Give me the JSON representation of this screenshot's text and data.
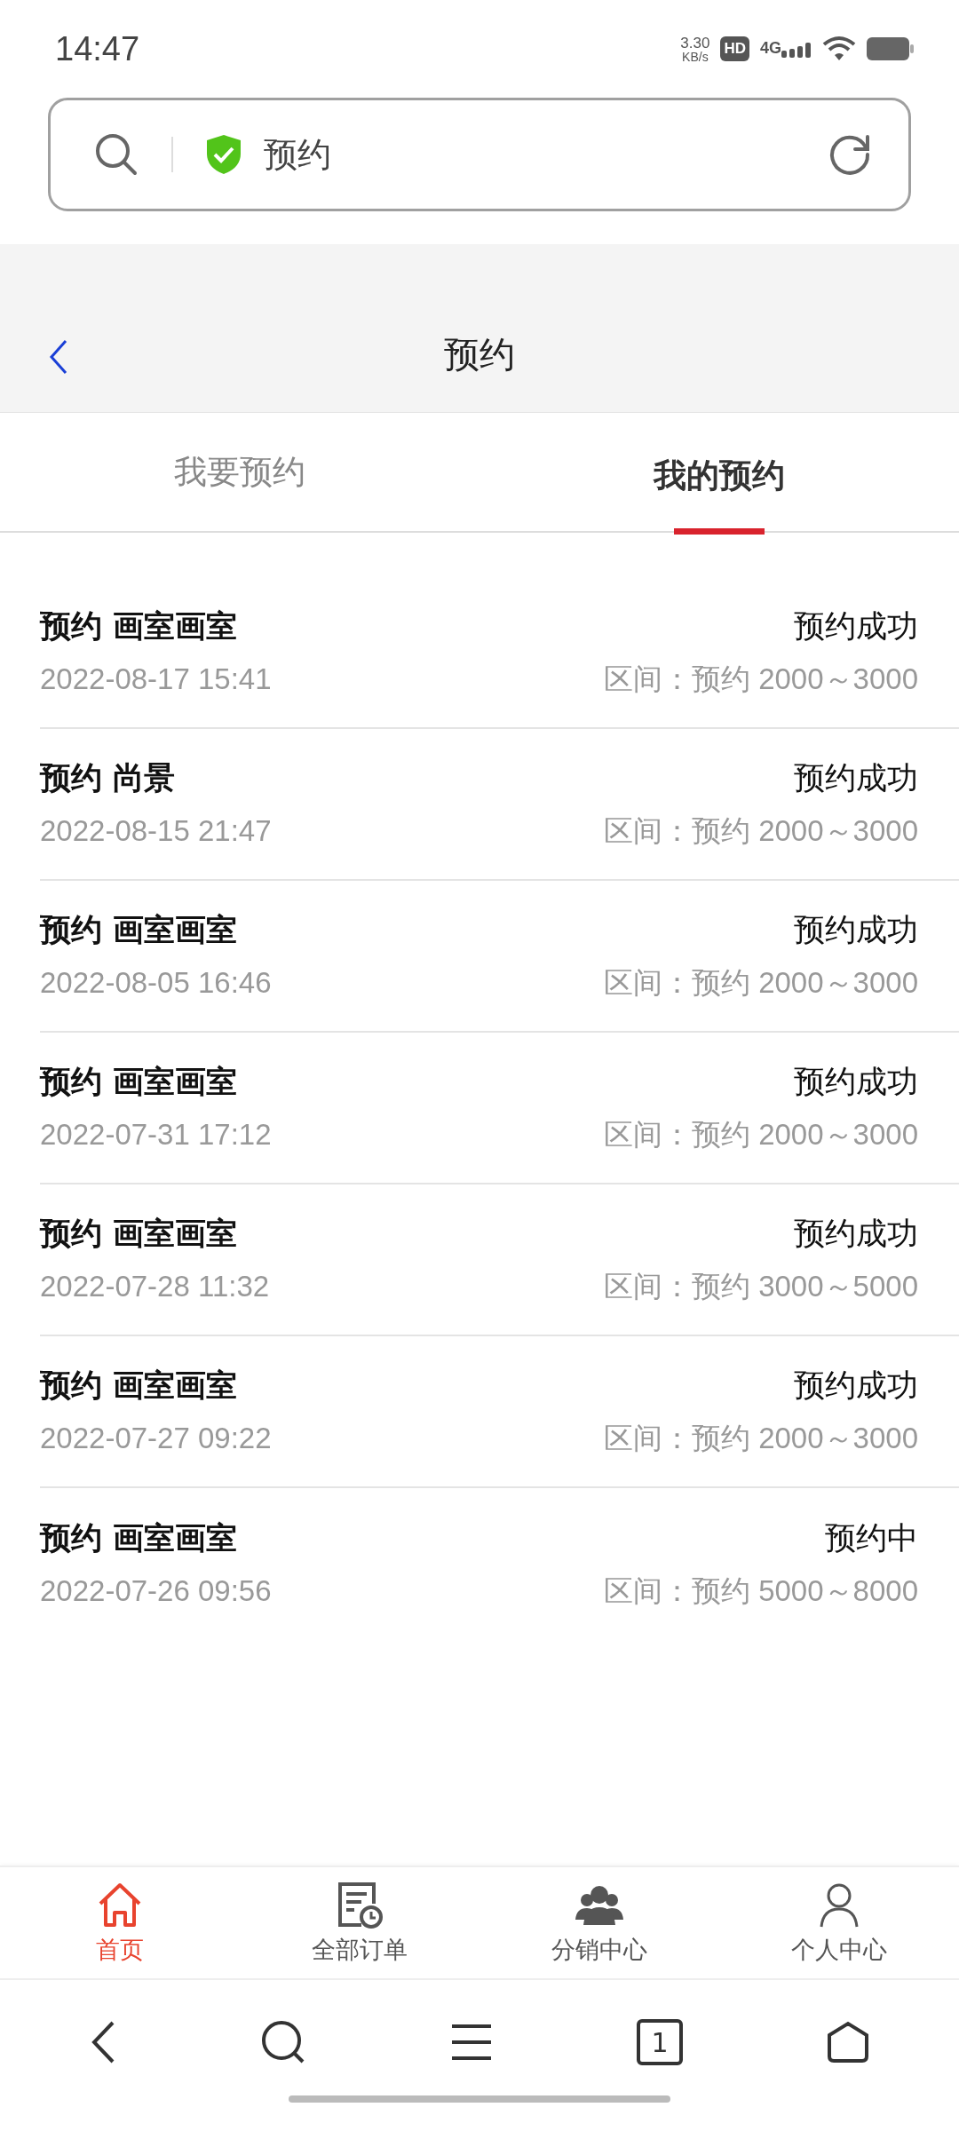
{
  "status_bar": {
    "time": "14:47",
    "speed": "3.30",
    "speed_unit": "KB/s",
    "hd": "HD",
    "network": "4G"
  },
  "address_bar": {
    "value": "预约"
  },
  "header": {
    "title": "预约"
  },
  "tabs": [
    {
      "label": "我要预约",
      "selected": false
    },
    {
      "label": "我的预约",
      "selected": true
    }
  ],
  "reservations": [
    {
      "title": "预约 画室画室",
      "time": "2022-08-17 15:41",
      "status": "预约成功",
      "range": "区间：预约 2000～3000"
    },
    {
      "title": "预约 尚景",
      "time": "2022-08-15 21:47",
      "status": "预约成功",
      "range": "区间：预约 2000～3000"
    },
    {
      "title": "预约 画室画室",
      "time": "2022-08-05 16:46",
      "status": "预约成功",
      "range": "区间：预约 2000～3000"
    },
    {
      "title": "预约 画室画室",
      "time": "2022-07-31 17:12",
      "status": "预约成功",
      "range": "区间：预约 2000～3000"
    },
    {
      "title": "预约 画室画室",
      "time": "2022-07-28 11:32",
      "status": "预约成功",
      "range": "区间：预约 3000～5000"
    },
    {
      "title": "预约 画室画室",
      "time": "2022-07-27 09:22",
      "status": "预约成功",
      "range": "区间：预约 2000～3000"
    },
    {
      "title": "预约 画室画室",
      "time": "2022-07-26 09:56",
      "status": "预约中",
      "range": "区间：预约 5000～8000"
    }
  ],
  "bottom_nav": [
    {
      "kind": "home",
      "label": "首页",
      "selected": true
    },
    {
      "kind": "orders",
      "label": "全部订单",
      "selected": false
    },
    {
      "kind": "team",
      "label": "分销中心",
      "selected": false
    },
    {
      "kind": "profile",
      "label": "个人中心",
      "selected": false
    }
  ],
  "browser_bar": {
    "tab_count": "1"
  }
}
